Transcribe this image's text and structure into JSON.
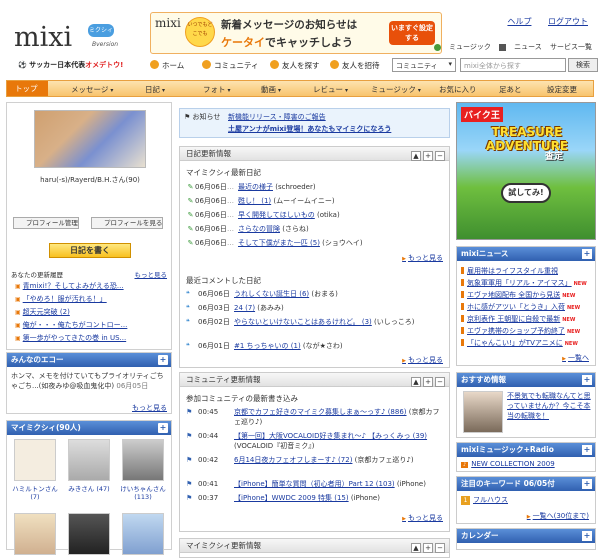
{
  "header": {
    "logo": "mixi",
    "logo_badge": "ミクシィ",
    "logo_version": "Bversion",
    "sponsor_prefix": "⚽ サッカー日本代表",
    "sponsor_red": "オメデトウ!",
    "banner": {
      "mixi": "mixi",
      "circle": "いつでもどこでも",
      "line1": "新着メッセージのお知らせは",
      "line2_a": "ケータイ",
      "line2_b": "でキャッチしよう",
      "button": "いますぐ設定する"
    },
    "top_links": [
      "ヘルプ",
      "ログアウト"
    ],
    "services": [
      "ミュージック",
      "ニュース",
      "サービス一覧"
    ]
  },
  "nav1": {
    "items": [
      "ホーム",
      "コミュニティ",
      "友人を探す",
      "友人を招待"
    ],
    "select_value": "コミュニティ",
    "search_placeholder": "mixi全体から探す",
    "search_button": "検索"
  },
  "nav2": {
    "items": [
      "トップ",
      "メッセージ",
      "日記",
      "フォト",
      "動画",
      "レビュー",
      "ミュージック",
      "お気に入り",
      "足あと",
      "設定変更"
    ]
  },
  "profile": {
    "name": "haru(-s)/Rayerd/B.H.さん(90)",
    "btn_manage": "プロフィール管理",
    "btn_view": "プロフィールを見る",
    "diary_button": "日記を書く",
    "history_title": "あなたの更新履歴",
    "more": "もっと見る",
    "history": [
      "青mixi!？そしてよみがえる恐...",
      "「やめろ！服が汚れる！」",
      "超天元突破 (2)",
      "俺が・・・俺たちがコントロー...",
      "第一歩がやってきたの巻 in US..."
    ]
  },
  "echo": {
    "title": "みんなのエコー",
    "text": "ホンマ、メモを付けていてもプライオリティごちゃごち...(如夜みゆ@吸血鬼化中)",
    "date": "06月05日",
    "more": "もっと見る"
  },
  "mymixi": {
    "title": "マイミクシィ(90人)",
    "friends": [
      {
        "name": "ハミルトンさん (7)"
      },
      {
        "name": "みきさん (47)"
      },
      {
        "name": "けいちゃんさん (113)"
      }
    ]
  },
  "news": {
    "label": "お知らせ",
    "items": [
      "新機能リリース・障害のご報告",
      "土屋アンナがmixi登場！あなたもマイミクになろう"
    ]
  },
  "diary": {
    "head": "日記更新情報",
    "title": "マイミクシィ最新日記",
    "more": "もっと見る",
    "rows": [
      {
        "date": "06月06日",
        "title": "最近の様子",
        "author": "(schroeder)"
      },
      {
        "date": "06月06日",
        "title": "甦し！ (1)",
        "author": "(ムーイームイニー)"
      },
      {
        "date": "06月06日",
        "title": "早く開発してほしいもの",
        "author": "(otika)"
      },
      {
        "date": "06月06日",
        "title": "さらなの冒険",
        "author": "(さらね)"
      },
      {
        "date": "06月06日",
        "title": "そして下僕がまた一匹 (5)",
        "author": "(ショウヘイ)"
      }
    ]
  },
  "comments": {
    "title": "最近コメントした日記",
    "more": "もっと見る",
    "rows": [
      {
        "date": "06月06日",
        "title": "うれしくない誕生日 (6)",
        "author": "(おまる)"
      },
      {
        "date": "06月03日",
        "title": "24 (7)",
        "author": "(あみみ)"
      },
      {
        "date": "06月02日",
        "title": "やらないといけないことはあるけれど。 (3)",
        "author": "(いしっころ)"
      },
      {
        "date": "06月01日",
        "title": "#1 ちっちゃいの (1)",
        "author": "(なが★さわ)"
      }
    ]
  },
  "community": {
    "head": "コミュニティ更新情報",
    "title": "参加コミュニティの最新書き込み",
    "more": "もっと見る",
    "rows": [
      {
        "time": "00:45",
        "title": "京都でカフェ好きのマイミク募集しまぁ～っす♪ (886)",
        "author": "(京都カフェ巡り♪)"
      },
      {
        "time": "00:44",
        "title": "【第一回】大阪VOCALOID好き集まれ～♪ 【みっくみっ (39)",
        "author": "(VOCALOID『初音ミク』)"
      },
      {
        "time": "00:42",
        "title": "6月14日夜カフェオフしまーす♪ (72)",
        "author": "(京都カフェ巡り♪)"
      },
      {
        "time": "00:41",
        "title": "【iPhone】簡単な質問（初心者用）Part 12 (103)",
        "author": "(iPhone)"
      },
      {
        "time": "00:37",
        "title": "【iPhone】WWDC 2009 特集 (15)",
        "author": "(iPhone)"
      }
    ]
  },
  "mymixi_update": {
    "head": "マイミクシィ更新情報"
  },
  "ad": {
    "brand": "バイク王",
    "title": "TREASURE ADVENTURE",
    "subtitle": "査定",
    "button": "試してみ!"
  },
  "mixi_news": {
    "title": "mixiニュース",
    "more": "一覧へ",
    "items": [
      {
        "text": "雇用帯はライフスタイル重視",
        "new": false
      },
      {
        "text": "気象軍軍用「リアル・アイマス」",
        "new": true
      },
      {
        "text": "エヴァ地図配布 全国から見送",
        "new": true
      },
      {
        "text": "ホに感がアツい「とうき」入荷",
        "new": true
      },
      {
        "text": "京利表作 王朝聖に自殺で最新",
        "new": true
      },
      {
        "text": "エヴァ携帯のショップ予約終了",
        "new": true
      },
      {
        "text": "「にゃんこい!」がTVアニメに",
        "new": true
      }
    ]
  },
  "recommend": {
    "title": "おすすめ情報",
    "text": "不景気でも転職なんてと思っていませんか？今こそ本当の転職を！"
  },
  "music": {
    "title": "mixiミュージック+Radio",
    "item": "NEW COLLECTION 2009"
  },
  "keyword": {
    "title": "注目のキーワード 06/05付",
    "item": "フルハウス",
    "more": "一覧へ(30位まで)"
  },
  "calendar": {
    "title": "カレンダー"
  },
  "colors": {
    "nav_orange": "#e8780a",
    "blue_head": "#3060b0",
    "link": "#1a3aa0"
  }
}
